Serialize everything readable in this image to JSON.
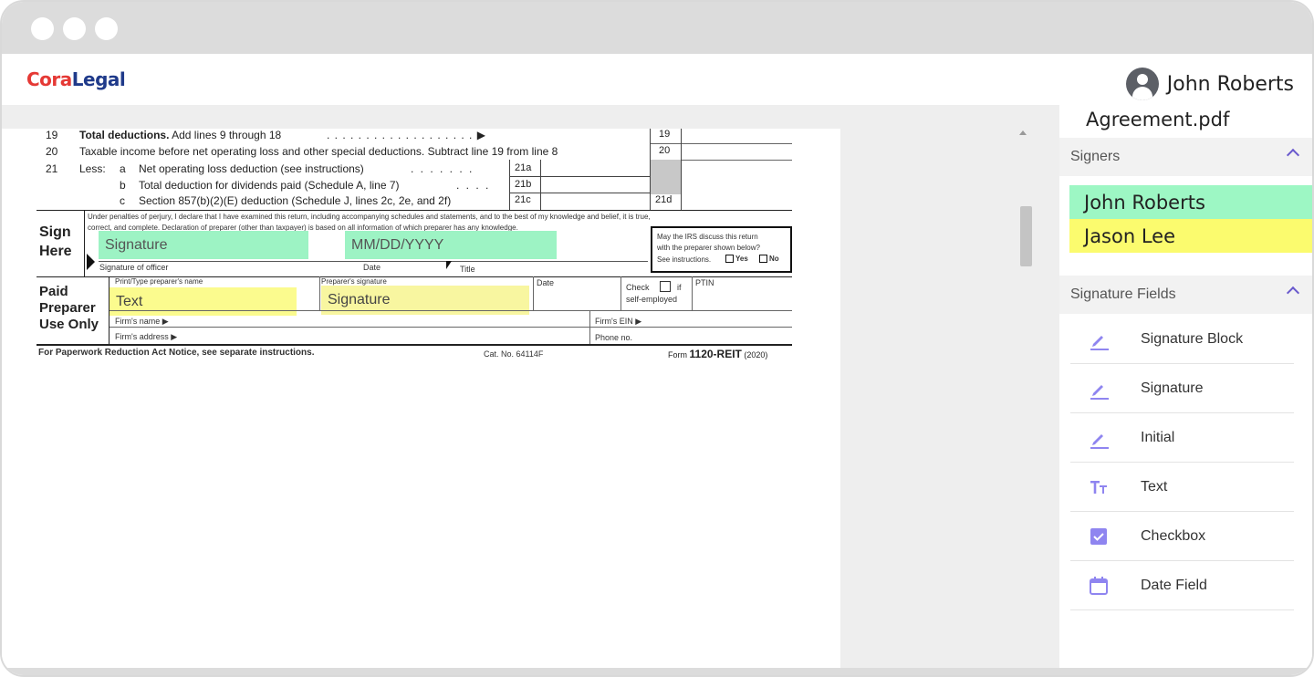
{
  "app": {
    "logo_part1": "Cora",
    "logo_part2": "Legal",
    "user_name": "John Roberts"
  },
  "document": {
    "filename": "Agreement.pdf",
    "form": {
      "line19_num": "19",
      "line19_text_bold": "Total deductions.",
      "line19_text": " Add lines 9 through 18",
      "line19_dots": ". . . . . . . . . . . . . . . . . . . ▶",
      "line19_box": "19",
      "line20_num": "20",
      "line20_text": "Taxable income before net operating loss and other special deductions. Subtract line 19 from line 8",
      "line20_box": "20",
      "line21_num": "21",
      "line21_less": "Less:",
      "line21a_letter": "a",
      "line21a_text": "Net operating loss deduction (see instructions)",
      "line21a_dots": ". . . . . . .",
      "line21a_box": "21a",
      "line21b_letter": "b",
      "line21b_text": "Total deduction for dividends paid (Schedule A, line 7)",
      "line21b_dots": ". . . .",
      "line21b_box": "21b",
      "line21c_letter": "c",
      "line21c_text": "Section 857(b)(2)(E) deduction (Schedule J, lines 2c, 2e, and 2f)",
      "line21c_box": "21c",
      "line21d_box": "21d",
      "perjury_line1": "Under penalties of perjury, I declare that I have examined this return, including accompanying schedules and statements, and to the best of my knowledge and belief, it is true,",
      "perjury_line2": "correct, and complete. Declaration of preparer (other than taxpayer) is based on all information of which preparer has any knowledge.",
      "sign_here_1": "Sign",
      "sign_here_2": "Here",
      "sig_officer_label": "Signature of officer",
      "date_label": "Date",
      "title_label": "Title",
      "irs_discuss_1": "May the IRS discuss this return",
      "irs_discuss_2": "with the preparer shown below?",
      "irs_discuss_3": "See instructions.",
      "yes": "Yes",
      "no": "No",
      "paid_1": "Paid",
      "paid_2": "Preparer",
      "paid_3": "Use Only",
      "preparer_name_label": "Print/Type preparer's name",
      "preparer_sig_label": "Preparer's signature",
      "prep_date_label": "Date",
      "check_label": "Check",
      "if_label": "if",
      "self_employed": "self-employed",
      "ptin": "PTIN",
      "firm_name": "Firm's name ▶",
      "firm_ein": "Firm's EIN ▶",
      "firm_address": "Firm's address ▶",
      "phone": "Phone no.",
      "footer_left": "For Paperwork Reduction Act Notice, see separate instructions.",
      "footer_cat": "Cat. No. 64114F",
      "footer_form_prefix": "Form",
      "footer_form": "1120-REIT",
      "footer_year": "(2020)"
    },
    "placed_fields": {
      "signature_green": "Signature",
      "date_green": "MM/DD/YYYY",
      "text_yellow": "Text",
      "signature_yellow": "Signature"
    }
  },
  "panel": {
    "signers_header": "Signers",
    "signers": [
      {
        "name": "John Roberts",
        "color": "#9df7c4"
      },
      {
        "name": "Jason Lee",
        "color": "#fbfb6e"
      }
    ],
    "fields_header": "Signature Fields",
    "fields": [
      {
        "label": "Signature Block",
        "icon": "pen-icon"
      },
      {
        "label": "Signature",
        "icon": "pen-icon"
      },
      {
        "label": "Initial",
        "icon": "pen-icon"
      },
      {
        "label": "Text",
        "icon": "text-icon"
      },
      {
        "label": "Checkbox",
        "icon": "checkbox-icon"
      },
      {
        "label": "Date Field",
        "icon": "calendar-icon"
      }
    ]
  },
  "colors": {
    "accent": "#6c5ce7",
    "logo_red": "#e53935",
    "logo_blue": "#1f3a8a"
  }
}
